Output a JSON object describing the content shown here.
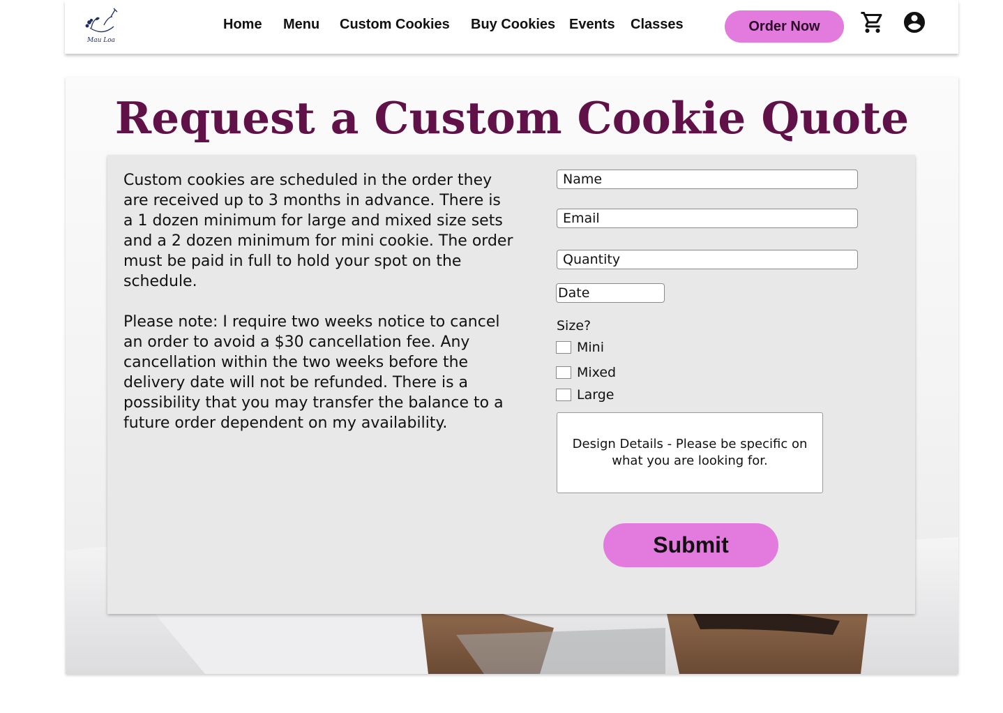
{
  "nav": {
    "brand": "Mau Loa Sweets",
    "links": [
      "Home",
      "Menu",
      "Custom Cookies",
      "Buy Cookies",
      "Events",
      "Classes"
    ],
    "order_now": "Order Now",
    "cart_icon": "cart-icon",
    "account_icon": "account-icon"
  },
  "hero": {
    "title": "Request a Custom Cookie Quote"
  },
  "info": {
    "paragraph1": "Custom cookies are scheduled in the order they are received up to 3 months in advance.  There is a 1 dozen minimum for large and mixed size sets and a 2 dozen minimum for mini cookie.  The order must be paid in full to hold your spot on the schedule.",
    "paragraph2": "Please note: I require two weeks notice to cancel an order to avoid a $30 cancellation fee.  Any cancellation within the two weeks before the delivery date will not be refunded.  There is a possibility that you may transfer the balance to a future order dependent on my availability."
  },
  "form": {
    "name_placeholder": "Name",
    "email_placeholder": "Email",
    "quantity_placeholder": "Quantity",
    "date_placeholder": "Date",
    "size_label": "Size?",
    "size_options": [
      "Mini",
      "Mixed",
      "Large"
    ],
    "details_placeholder": "Design Details - Please be specific on what you are looking for.",
    "submit_label": "Submit"
  },
  "colors": {
    "accent": "#e37add",
    "title": "#5f1148",
    "panel": "#e8e8e8"
  }
}
